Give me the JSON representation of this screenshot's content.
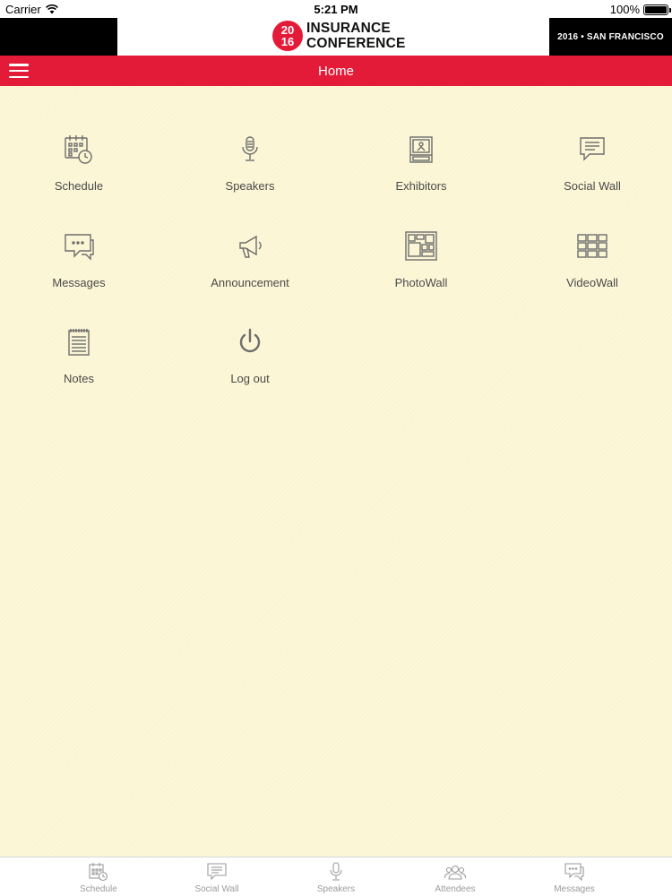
{
  "status_bar": {
    "carrier": "Carrier",
    "time": "5:21 PM",
    "battery": "100%"
  },
  "banner": {
    "logo_year_top": "20",
    "logo_year_bottom": "16",
    "logo_line1": "INSURANCE",
    "logo_line2": "CONFERENCE",
    "event_info": "2016 • SAN FRANCISCO"
  },
  "navbar": {
    "title": "Home",
    "menu_icon": "hamburger-menu-icon"
  },
  "tiles": [
    {
      "label": "Schedule",
      "icon": "calendar-clock-icon"
    },
    {
      "label": "Speakers",
      "icon": "microphone-icon"
    },
    {
      "label": "Exhibitors",
      "icon": "booth-icon"
    },
    {
      "label": "Social Wall",
      "icon": "chat-board-icon"
    },
    {
      "label": "Messages",
      "icon": "speech-bubbles-icon"
    },
    {
      "label": "Announcement",
      "icon": "megaphone-icon"
    },
    {
      "label": "PhotoWall",
      "icon": "photo-collage-icon"
    },
    {
      "label": "VideoWall",
      "icon": "video-grid-icon"
    },
    {
      "label": "Notes",
      "icon": "notepad-icon"
    },
    {
      "label": "Log out",
      "icon": "power-icon"
    }
  ],
  "tabbar": [
    {
      "label": "Schedule",
      "icon": "calendar-clock-icon"
    },
    {
      "label": "Social Wall",
      "icon": "chat-board-icon"
    },
    {
      "label": "Speakers",
      "icon": "microphone-icon"
    },
    {
      "label": "Attendees",
      "icon": "people-icon"
    },
    {
      "label": "Messages",
      "icon": "speech-bubbles-icon"
    }
  ],
  "colors": {
    "accent": "#e41b38",
    "background": "#fbf5d2",
    "icon_gray": "#6d6d6d",
    "tab_gray": "#9b9b9b"
  }
}
